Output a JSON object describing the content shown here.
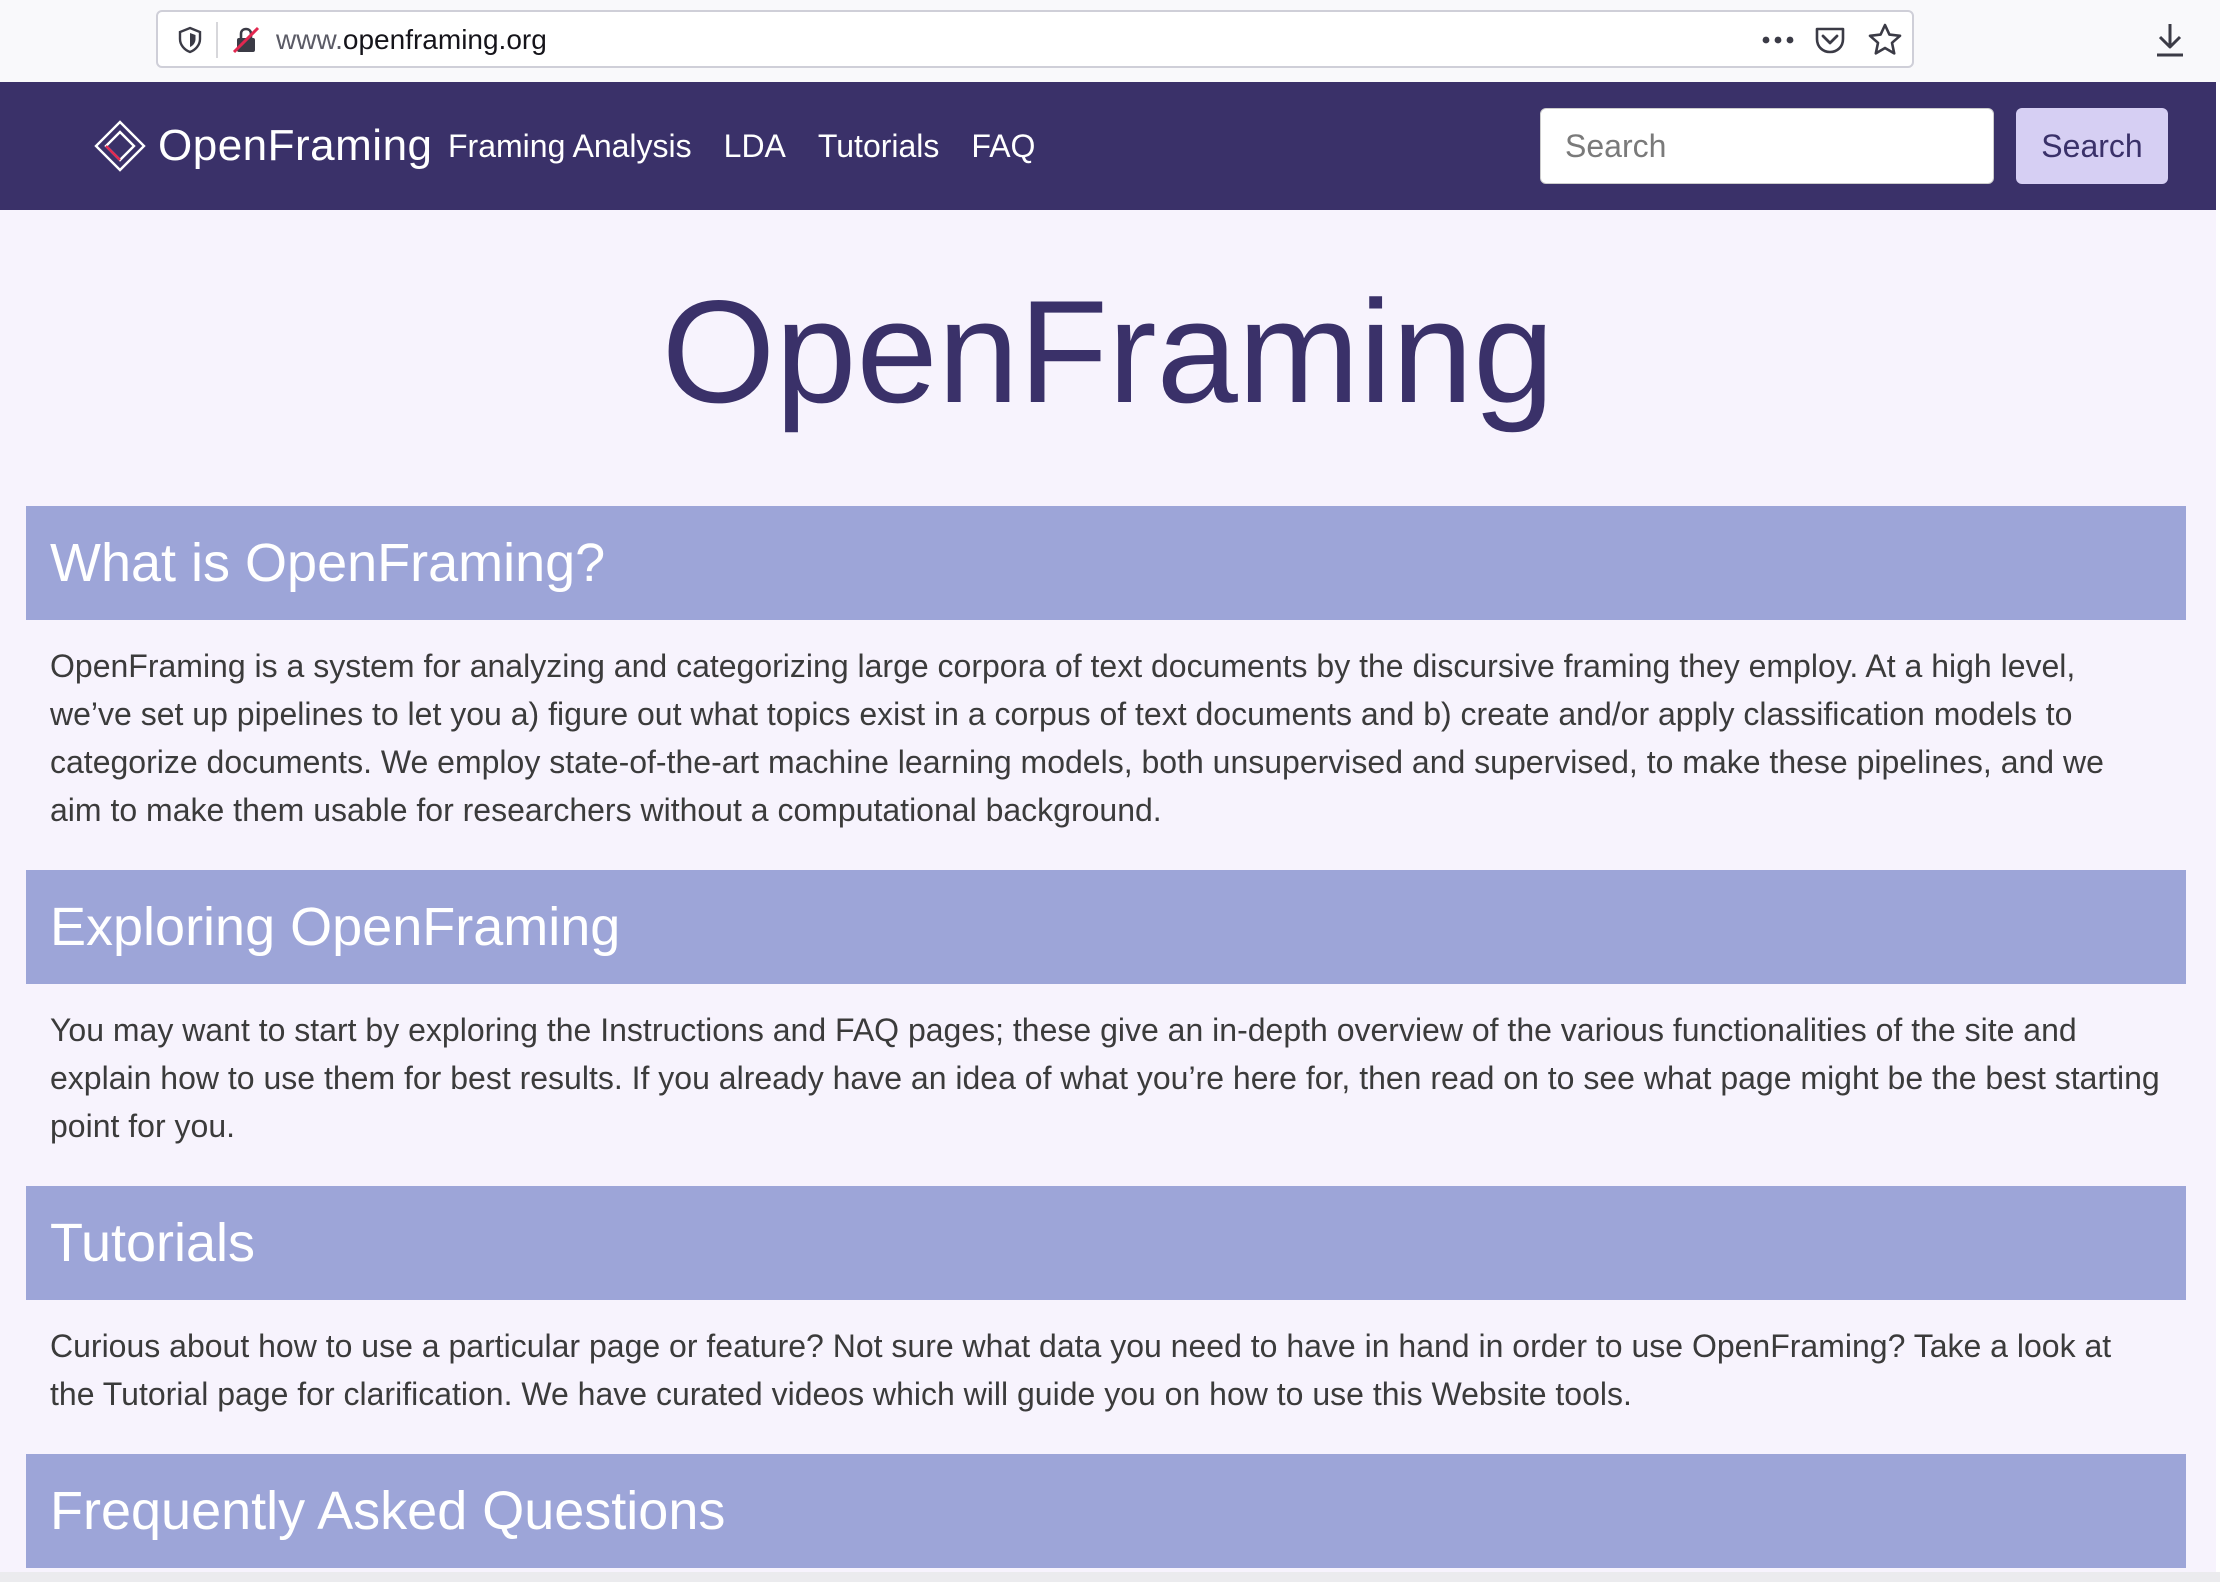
{
  "browser": {
    "url_prefix": "www.",
    "url_domain": "openframing.org",
    "icons": [
      "shield-icon",
      "tracking-protection-icon",
      "more-icon",
      "pocket-icon",
      "bookmark-star-icon",
      "download-icon"
    ]
  },
  "nav": {
    "brand": "OpenFraming",
    "links": [
      "Framing Analysis",
      "LDA",
      "Tutorials",
      "FAQ"
    ],
    "search_placeholder": "Search",
    "search_button": "Search",
    "colors": {
      "nav_bg": "#3a3169",
      "search_button_bg": "#d6cff3"
    }
  },
  "main": {
    "title": "OpenFraming",
    "sections": [
      {
        "heading": "What is OpenFraming?",
        "body": "OpenFraming is a system for analyzing and categorizing large corpora of text documents by the discursive framing they employ. At a high level, we’ve set up pipelines to let you a) figure out what topics exist in a corpus of text documents and b) create and/or apply classification models to categorize documents. We employ state-of-the-art machine learning models, both unsupervised and supervised, to make these pipelines, and we aim to make them usable for researchers without a computational background."
      },
      {
        "heading": "Exploring OpenFraming",
        "body": "You may want to start by exploring the Instructions and FAQ pages; these give an in-depth overview of the various functionalities of the site and explain how to use them for best results. If you already have an idea of what you’re here for, then read on to see what page might be the best starting point for you."
      },
      {
        "heading": "Tutorials",
        "body": "Curious about how to use a particular page or feature? Not sure what data you need to have in hand in order to use OpenFraming? Take a look at the Tutorial page for clarification. We have curated videos which will guide you on how to use this Website tools."
      },
      {
        "heading": "Frequently Asked Questions",
        "body": ""
      }
    ],
    "colors": {
      "page_bg": "#f7f3fd",
      "section_header_bg": "#9da5d8",
      "title": "#3a3169"
    }
  }
}
